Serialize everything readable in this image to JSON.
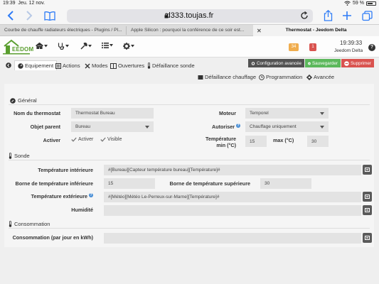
{
  "status_bar": {
    "time": "19:39",
    "date": "Jeu. 12 nov.",
    "battery": "59 %"
  },
  "browser": {
    "url": "d333.toujas.fr",
    "tabs": [
      {
        "label": "Courbe de chauffe radiateurs électriques - Plugins / Pl..."
      },
      {
        "label": "Apple Silicon : pourquoi la conférence de ce soir est..."
      },
      {
        "label": "Thermostat - Jeedom Delta"
      }
    ]
  },
  "header": {
    "logo_text": "EEDOM",
    "badge_count": "34",
    "badge_alert": "1",
    "time": "19:39:33",
    "box_name": "Jeedom Delta",
    "help": "?"
  },
  "actions": {
    "config": "Configuration avancée",
    "save": "Sauvegarder",
    "delete": "Supprimer"
  },
  "tabs_main": [
    "Equipement",
    "Actions",
    "Modes",
    "Ouvertures",
    "Défaillance sonde"
  ],
  "tabs_second": [
    "Défaillance chauffage",
    "Programmation",
    "Avancée"
  ],
  "form": {
    "general_title": "Général",
    "name_label": "Nom du thermostat",
    "name_value": "Thermostat Bureau",
    "parent_label": "Objet parent",
    "parent_value": "Bureau",
    "active_label": "Activer",
    "active_check": "Activer",
    "visible_check": "Visible",
    "moteur_label": "Moteur",
    "moteur_value": "Temporel",
    "autoriser_label": "Autoriser",
    "autoriser_value": "Chauffage uniquement",
    "temp_label": "Température",
    "temp_min_label": "min (°C)",
    "temp_min_value": "15",
    "temp_max_label": "max (°C)",
    "temp_max_value": "30",
    "sonde_title": "Sonde",
    "temp_int_label": "Température intérieure",
    "temp_int_value": "#[Bureau][Capteur température bureau][Température]#",
    "borne_inf_label": "Borne de température inférieure",
    "borne_inf_value": "15",
    "borne_sup_label": "Borne de température supérieure",
    "borne_sup_value": "30",
    "temp_ext_label": "Température extérieure",
    "temp_ext_value": "#[Météo][Météo Le-Perreux-sur-Marne][Température]#",
    "humidite_label": "Humidité",
    "humidite_value": "",
    "conso_title": "Consommation",
    "conso_label": "Consommation (par jour en kWh)",
    "conso_value": ""
  },
  "colors": {
    "config": "#525252",
    "save": "#5cb85c",
    "delete": "#d9534f",
    "badge_count": "#f0ad4e",
    "badge_alert": "#d9534f",
    "accent_blue": "#2f7cf6",
    "logo_green": "#5a9e2f"
  }
}
